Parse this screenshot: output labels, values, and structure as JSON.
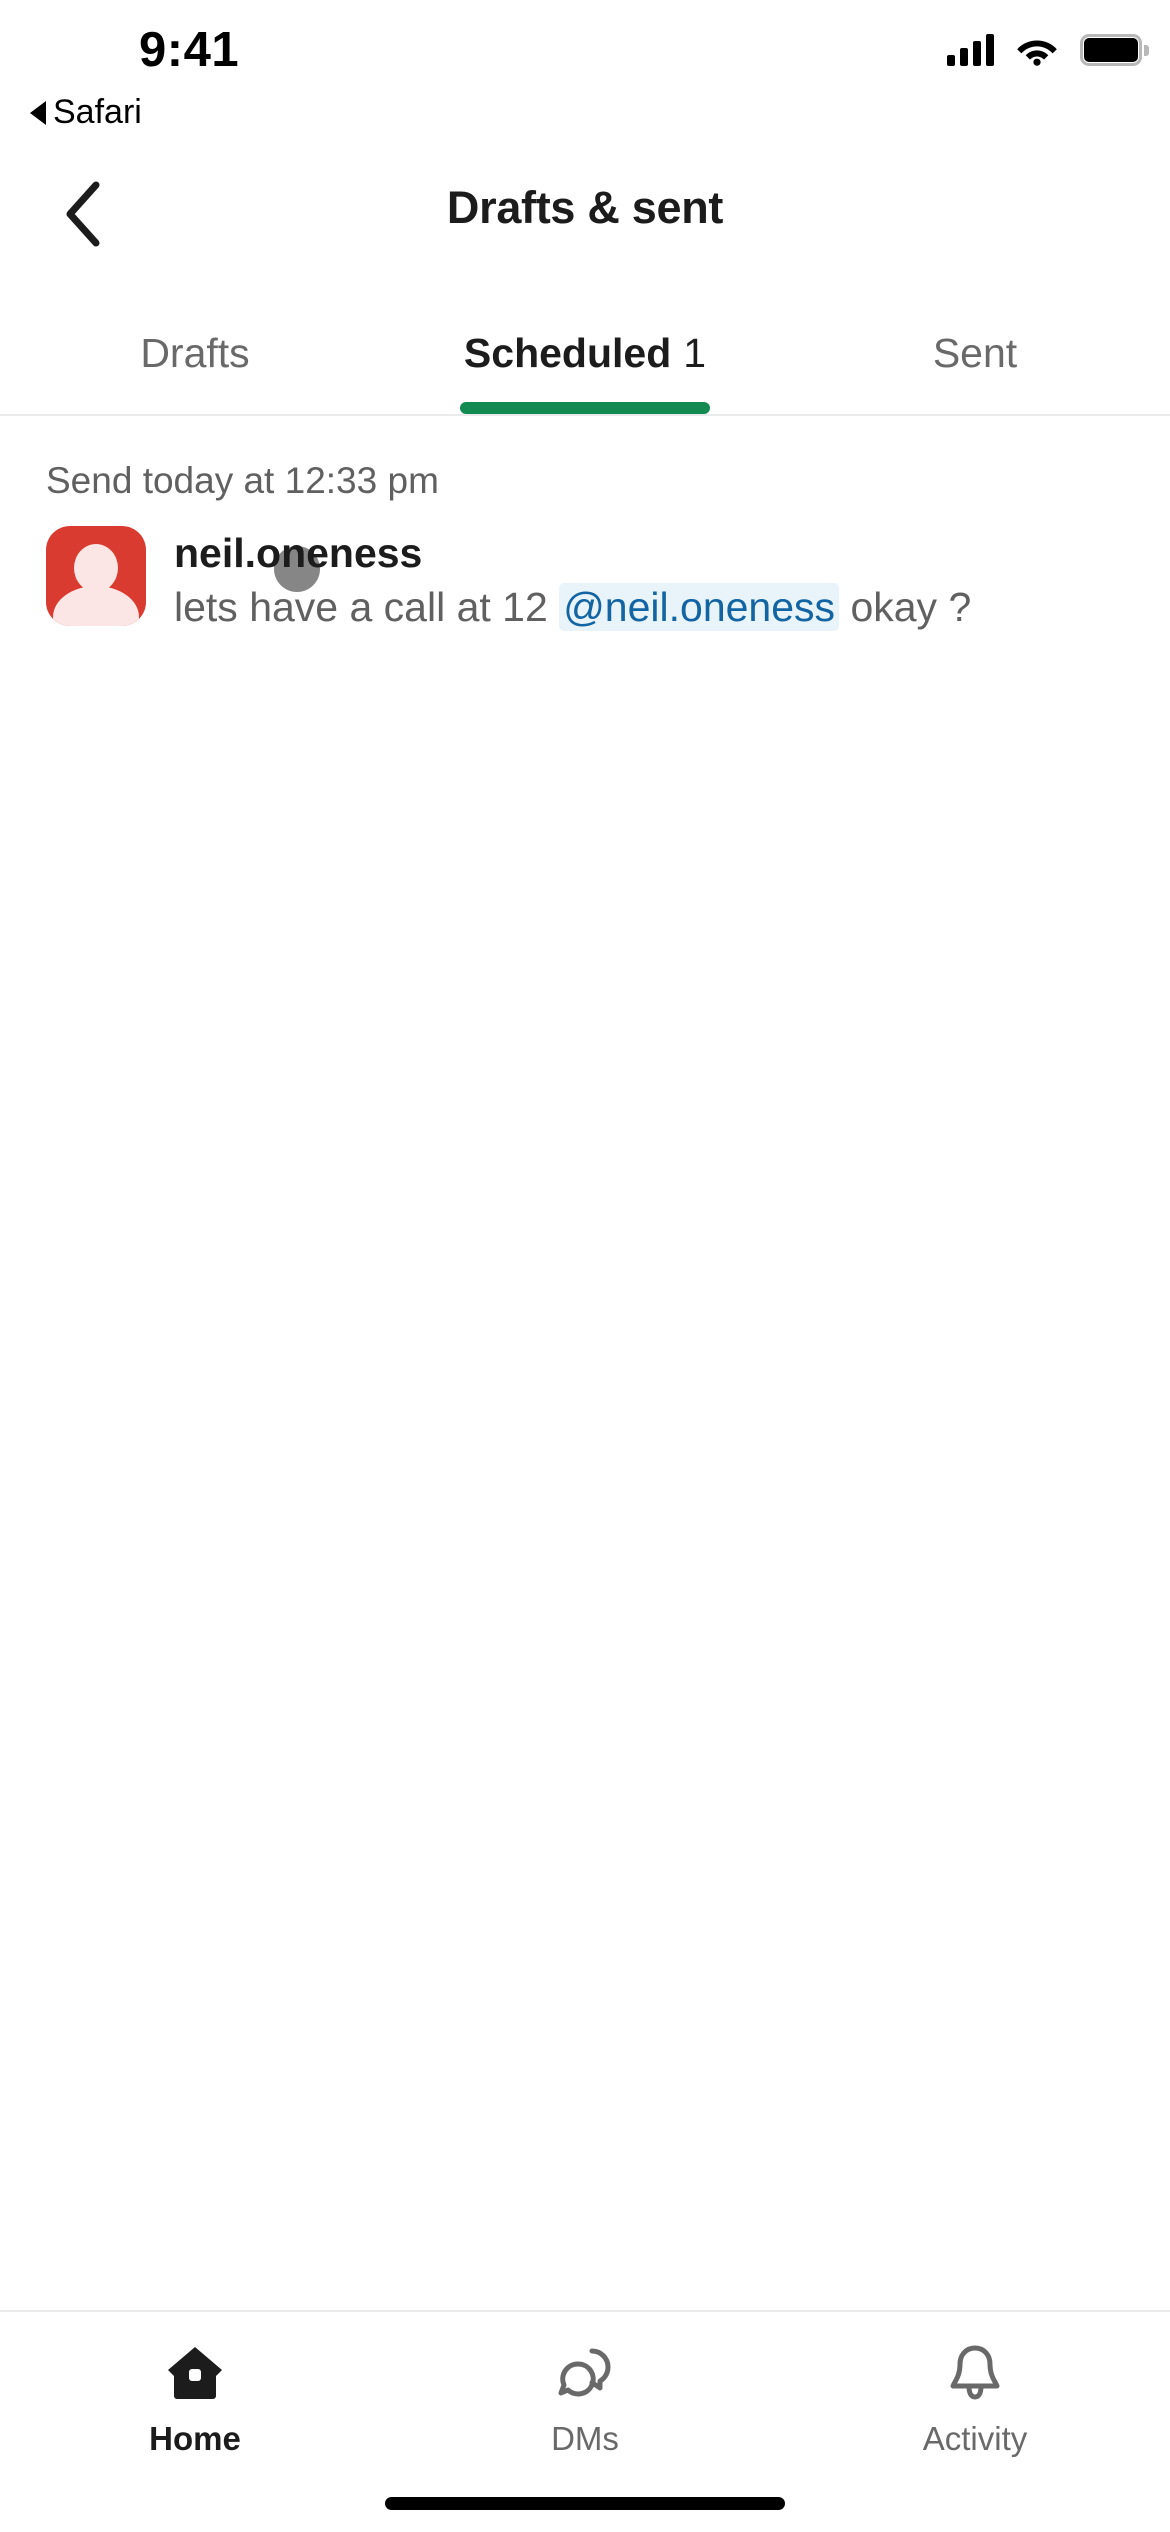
{
  "status_bar": {
    "time": "9:41",
    "back_app_label": "Safari",
    "back_indicator_icon": "triangle-left-icon",
    "cellular_icon": "cellular-bars-icon",
    "wifi_icon": "wifi-icon",
    "battery_icon": "battery-full-icon"
  },
  "header": {
    "back_icon": "chevron-left-icon",
    "title": "Drafts & sent"
  },
  "tabs": {
    "items": [
      {
        "label": "Drafts",
        "count": "",
        "active": false
      },
      {
        "label": "Scheduled",
        "count": "1",
        "active": true
      },
      {
        "label": "Sent",
        "count": "",
        "active": false
      }
    ],
    "active_indicator_color": "#148A53"
  },
  "list": {
    "schedule_label": "Send today at 12:33 pm",
    "message": {
      "avatar_icon": "user-avatar-icon",
      "avatar_color": "#D93B30",
      "username": "neil.oneness",
      "text_before_mention": "lets have a call at 12 ",
      "mention": "@neil.oneness",
      "text_after_mention": "okay ?",
      "mention_color": "#1264A3",
      "mention_background": "#E8F3FA"
    }
  },
  "bottom_nav": {
    "items": [
      {
        "label": "Home",
        "icon": "home-icon",
        "active": true
      },
      {
        "label": "DMs",
        "icon": "chat-bubbles-icon",
        "active": false
      },
      {
        "label": "Activity",
        "icon": "bell-icon",
        "active": false
      }
    ]
  }
}
